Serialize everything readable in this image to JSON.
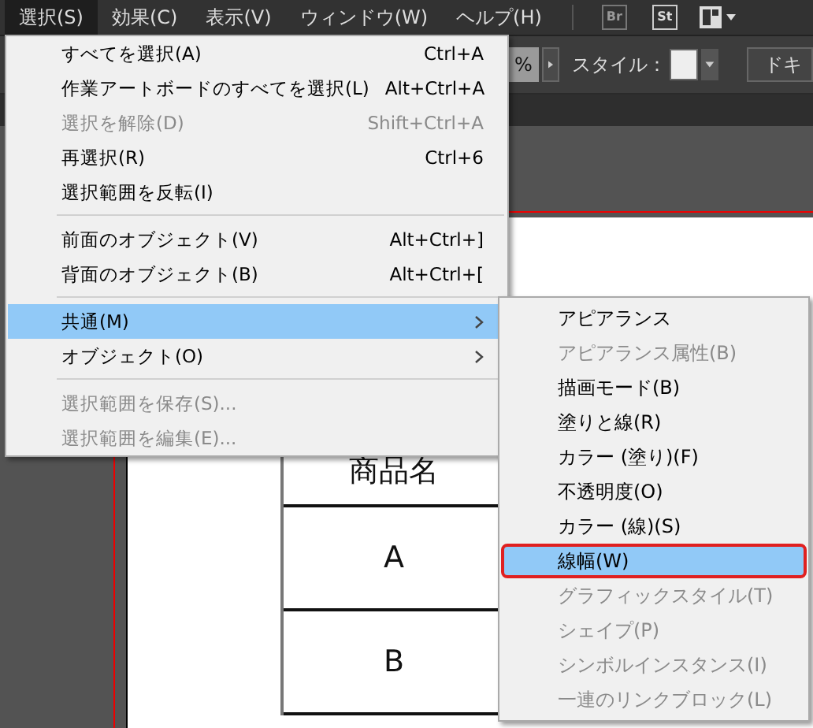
{
  "menubar": {
    "items": [
      {
        "label": "選択(S)",
        "selected": true
      },
      {
        "label": "効果(C)",
        "selected": false
      },
      {
        "label": "表示(V)",
        "selected": false
      },
      {
        "label": "ウィンドウ(W)",
        "selected": false
      },
      {
        "label": "ヘルプ(H)",
        "selected": false
      }
    ],
    "app_buttons": [
      "Br",
      "St"
    ]
  },
  "toolbar": {
    "opacity_field": {
      "value": "%"
    },
    "style_label": "スタイル：",
    "document_button": "ドキ"
  },
  "menu": {
    "items": [
      {
        "kind": "item",
        "label": "すべてを選択(A)",
        "shortcut": "Ctrl+A",
        "disabled": false,
        "selected": false,
        "submenu": false
      },
      {
        "kind": "item",
        "label": "作業アートボードのすべてを選択(L)",
        "shortcut": "Alt+Ctrl+A",
        "disabled": false,
        "selected": false,
        "submenu": false
      },
      {
        "kind": "item",
        "label": "選択を解除(D)",
        "shortcut": "Shift+Ctrl+A",
        "disabled": true,
        "selected": false,
        "submenu": false
      },
      {
        "kind": "item",
        "label": "再選択(R)",
        "shortcut": "Ctrl+6",
        "disabled": false,
        "selected": false,
        "submenu": false
      },
      {
        "kind": "item",
        "label": "選択範囲を反転(I)",
        "disabled": false,
        "selected": false,
        "submenu": false
      },
      {
        "kind": "separator"
      },
      {
        "kind": "item",
        "label": "前面のオブジェクト(V)",
        "shortcut": "Alt+Ctrl+]",
        "disabled": false,
        "selected": false,
        "submenu": false
      },
      {
        "kind": "item",
        "label": "背面のオブジェクト(B)",
        "shortcut": "Alt+Ctrl+[",
        "disabled": false,
        "selected": false,
        "submenu": false
      },
      {
        "kind": "separator"
      },
      {
        "kind": "item",
        "label": "共通(M)",
        "disabled": false,
        "selected": true,
        "submenu": true
      },
      {
        "kind": "item",
        "label": "オブジェクト(O)",
        "disabled": false,
        "selected": false,
        "submenu": true
      },
      {
        "kind": "separator"
      },
      {
        "kind": "item",
        "label": "選択範囲を保存(S)...",
        "disabled": true,
        "selected": false,
        "submenu": false
      },
      {
        "kind": "item",
        "label": "選択範囲を編集(E)...",
        "disabled": true,
        "selected": false,
        "submenu": false
      }
    ]
  },
  "submenu": {
    "items": [
      {
        "label": "アピアランス",
        "disabled": false,
        "selected": false,
        "annotated": false
      },
      {
        "label": "アピアランス属性(B)",
        "disabled": true,
        "selected": false,
        "annotated": false
      },
      {
        "label": "描画モード(B)",
        "disabled": false,
        "selected": false,
        "annotated": false
      },
      {
        "label": "塗りと線(R)",
        "disabled": false,
        "selected": false,
        "annotated": false
      },
      {
        "label": "カラー (塗り)(F)",
        "disabled": false,
        "selected": false,
        "annotated": false
      },
      {
        "label": "不透明度(O)",
        "disabled": false,
        "selected": false,
        "annotated": false
      },
      {
        "label": "カラー (線)(S)",
        "disabled": false,
        "selected": false,
        "annotated": false
      },
      {
        "label": "線幅(W)",
        "disabled": false,
        "selected": true,
        "annotated": true
      },
      {
        "label": "グラフィックスタイル(T)",
        "disabled": true,
        "selected": false,
        "annotated": false
      },
      {
        "label": "シェイプ(P)",
        "disabled": true,
        "selected": false,
        "annotated": false
      },
      {
        "label": "シンボルインスタンス(I)",
        "disabled": true,
        "selected": false,
        "annotated": false
      },
      {
        "label": "一連のリンクブロック(L)",
        "disabled": true,
        "selected": false,
        "annotated": false
      }
    ]
  },
  "table": {
    "cells": [
      "商品名",
      "A",
      "B"
    ]
  }
}
